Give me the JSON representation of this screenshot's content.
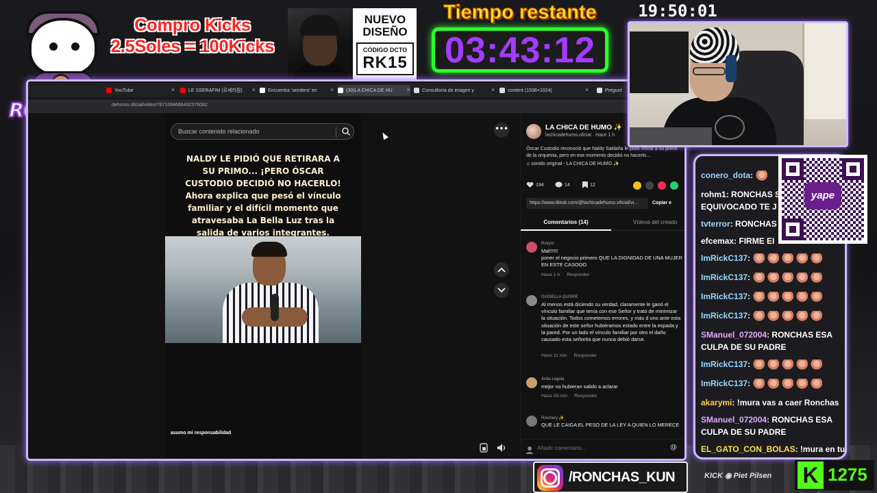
{
  "overlay": {
    "logo_text": "RONCHAS",
    "kicks_promo_line1": "Compro Kicks",
    "kicks_promo_line2": "2.5Soles = 100Kicks",
    "ad_title_line1": "NUEVO",
    "ad_title_line2": "DISEÑO",
    "ad_code_label": "CÓDIGO DCTO",
    "ad_code": "RK15",
    "timer_label": "Tiempo restante",
    "timer_value": "03:43:12",
    "clock": "19:50:01",
    "instagram_handle": "/RONCHAS_KUN",
    "sponsors_text": "KICK  ◉  Piet  Pilsen",
    "kick_logo": "K",
    "kick_count": "1275",
    "accent_purple": "#cdbbff",
    "timer_color": "#a23cff",
    "kick_green": "#53fc18"
  },
  "browser": {
    "tabs": [
      {
        "label": "YouTube",
        "favicon": "youtube-icon",
        "color": "#ff0000"
      },
      {
        "label": "LE SSERAFIM (르세라핌)",
        "favicon": "youtube-icon",
        "color": "#ff0000"
      },
      {
        "label": "Encuentra 'sendero' en",
        "favicon": "tiktok-icon",
        "color": "#ffffff"
      },
      {
        "label": "(30)LA CHICA DE HU",
        "favicon": "tiktok-icon",
        "color": "#ffffff"
      },
      {
        "label": "Consultoría de imagen y",
        "favicon": "site-icon",
        "color": "#dddddd"
      },
      {
        "label": "content (1536×1024)",
        "favicon": "site-icon",
        "color": "#dddddd"
      },
      {
        "label": "Pregunt",
        "favicon": "site-icon",
        "color": "#dddddd"
      }
    ],
    "url": "dehumo.oficial/video/7671064666432376082"
  },
  "player": {
    "search_placeholder": "Buscar contenido relacionado",
    "caption": "NALDY LE PIDIÓ QUE RETIRARA A SU PRIMO... ¡PERO ÓSCAR CUSTODIO DECIDIÓ NO HACERLO! Ahora explica que pesó el vínculo familiar y el difícil momento que atravesaba La Bella Luz tras la salida de varios integrantes.",
    "subtitle": "asumo mi responsabilidad",
    "more_label": "•••"
  },
  "post": {
    "author_name": "LA CHICA DE HUMO ✨",
    "author_handle": "lachicadehumo.oficial · Hace 1 h",
    "description": "Óscar Custodio reconoció que Naldy Saldaña le pidió retirar a su primo de la orquesta, pero en ese momento decidió no hacerlo...",
    "sound": "♫  sonido original - LA CHICA DE HUMO ✨",
    "likes": "194",
    "comments_count": "14",
    "saves": "12",
    "link": "https://www.tiktok.com/@lachicadehumo.oficial/vi...",
    "copy_label": "Copiar e",
    "tab_comments": "Comentarios (14)",
    "tab_videos": "Vídeos del creado",
    "input_placeholder": "Añadir comentario...",
    "input_at": "@"
  },
  "comments": [
    {
      "user": "Roxyrx",
      "text": "Mal!!!!!!\nponer el negocio primero QUE LA DIGNIDAD DE UNA MUJER EN ESTE CASOOO",
      "time": "Hace 1 h",
      "reply": "Responder"
    },
    {
      "user": "GUISELLA QUISPE",
      "text": "Al menos está diciendo su verdad, claramente le ganó el vínculo familiar que tenía con ese Señor y trató de minimizar la situación. Todos cometemos errores, y más d uno ante esta situación de este señor hubiéramos estado entre la espada y la pared. Por un lado el vínculo familiar por otro el daño causado esta señorita que nunca debió darse.",
      "time": "Hace 11 min",
      "reply": "Responder"
    },
    {
      "user": "Anita Legula",
      "text": "mejor no hubieran salido a aclarar",
      "time": "Hace 33 min",
      "reply": "Responder"
    },
    {
      "user": "Rosmery ✨",
      "text": "QUE LE CAIGA EL PESO DE LA LEY A QUIEN LO MERECE",
      "time": "",
      "reply": ""
    }
  ],
  "chat": [
    {
      "user": "conero_dota",
      "color": "#9ad7ff",
      "text": "",
      "emotes": 1
    },
    {
      "user": "rohm1",
      "color": "#ffffff",
      "text": "RONCHAS S",
      "line2": "EQUIVOCADO TE J",
      "emotes": 0
    },
    {
      "user": "tvterror",
      "color": "#9ad7ff",
      "text": "RONCHAS",
      "emotes": 0
    },
    {
      "user": "efcemax",
      "color": "#ffffff",
      "text": "FIRME EI",
      "emotes": 0
    },
    {
      "user": "ImRickC137",
      "color": "#9ad7ff",
      "text": "",
      "emotes": 5
    },
    {
      "user": "ImRickC137",
      "color": "#9ad7ff",
      "text": "",
      "emotes": 5
    },
    {
      "user": "ImRickC137",
      "color": "#9ad7ff",
      "text": "",
      "emotes": 5
    },
    {
      "user": "ImRickC137",
      "color": "#9ad7ff",
      "text": "",
      "emotes": 5
    },
    {
      "user": "SManuel_072004",
      "color": "#e0a8ff",
      "text": "RONCHAS ESA",
      "line2": "CULPA DE SU PADRE",
      "emotes": 0
    },
    {
      "user": "ImRickC137",
      "color": "#9ad7ff",
      "text": "",
      "emotes": 5
    },
    {
      "user": "ImRickC137",
      "color": "#9ad7ff",
      "text": "",
      "emotes": 5
    },
    {
      "user": "akarymi",
      "color": "#ffcf4a",
      "text": "!mura vas a caer Ronchas",
      "emotes": 0
    },
    {
      "user": "SManuel_072004",
      "color": "#e0a8ff",
      "text": "RONCHAS ESA",
      "line2": "CULPA DE SU PADRE",
      "emotes": 0
    },
    {
      "user": "EL_GATO_CON_BOLAS",
      "color": "#ffe14a",
      "text": "!mura en tu",
      "emotes": 0
    }
  ],
  "qr": {
    "label": "yape",
    "color": "#6b1f8c"
  }
}
